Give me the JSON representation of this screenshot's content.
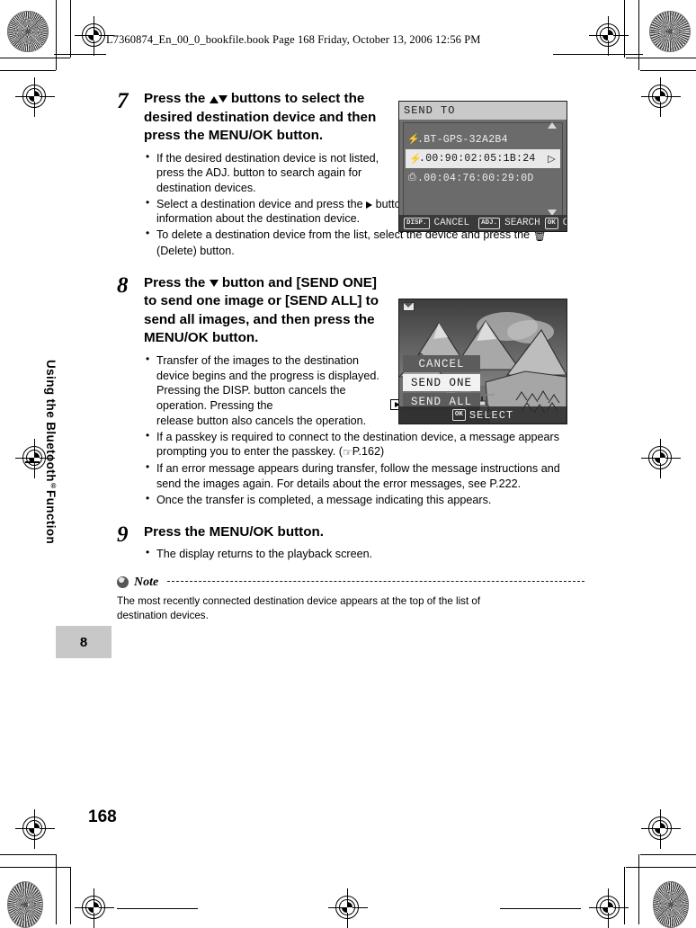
{
  "header": {
    "text": "L7360874_En_00_0_bookfile.book  Page 168  Friday, October 13, 2006  12:56 PM"
  },
  "sidebar": {
    "chapter_title": "Using the Bluetooth",
    "chapter_title_sup": "®",
    "chapter_title_tail": " Function",
    "chapter_number": "8"
  },
  "page": {
    "number": "168"
  },
  "steps": [
    {
      "number": "7",
      "title": "Press the ▲▼ buttons to select the desired destination device and then press the MENU/OK button.",
      "title_pre": "Press the ",
      "title_mid": " buttons to select the desired destination device and then press the MENU/OK button.",
      "bullets": [
        "If the desired destination device is not listed, press the ADJ. button to search again for destination devices.",
        "Select a destination device and press the ▶ button to display information about the destination device.",
        "To delete a destination device from the list, select the device and press the Ὕ1 (Delete) button."
      ],
      "bullet2_a": "Select a destination device and press the ",
      "bullet2_b": " button to display information about the destination device.",
      "bullet3_a": "To delete a destination device from the list, select the device and press the ",
      "bullet3_b": " (Delete) button."
    },
    {
      "number": "8",
      "title_a": "Press the ",
      "title_b": " button and [SEND ONE] to send one image or [SEND ALL] to send all images, and then press the MENU/OK button.",
      "bullet1_a": "Transfer of the images to the destination device begins and the progress is displayed. Pressing the DISP. button cancels the operation. Pressing the ",
      "bullet1_b": " (Playback) button or shutter release button also cancels the operation.",
      "bullet2_a": "If a passkey is required to connect to the destination device, a message appears prompting you to enter the passkey. (",
      "bullet2_b": "P.162)",
      "bullet3": "If an error message appears during transfer, follow the message instructions and send the images again. For details about the error messages, see P.222.",
      "bullet4": "Once the transfer is completed, a message indicating this appears."
    },
    {
      "number": "9",
      "title": "Press the MENU/OK button.",
      "bullets": [
        "The display returns to the playback screen."
      ]
    }
  ],
  "note": {
    "label": "Note",
    "text": "The most recently connected destination device appears at the top of the list of destination devices."
  },
  "lcd_send_to": {
    "title": "SEND TO",
    "rows": [
      {
        "icon": "bluetooth-icon",
        "glyph": "⚡",
        "label": ".BT-GPS-32A2B4",
        "selected": false
      },
      {
        "icon": "bluetooth-icon",
        "glyph": "⚡",
        "label": ".00:90:02:05:1B:24",
        "selected": true
      },
      {
        "icon": "printer-icon",
        "glyph": "⎙",
        "label": ".00:04:76:00:29:0D",
        "selected": false
      }
    ],
    "row_arrow": "▷",
    "footer": {
      "disp_key": "DISP.",
      "disp_label": "CANCEL",
      "adj_key": "ADJ.",
      "adj_label": "SEARCH",
      "ok_key": "OK",
      "ok_label": "OK"
    }
  },
  "lcd_send_menu": {
    "items": [
      {
        "label": "CANCEL",
        "selected": false
      },
      {
        "label": "SEND ONE",
        "selected": true
      },
      {
        "label": "SEND ALL",
        "selected": false
      }
    ],
    "footer": {
      "ok_key": "OK",
      "ok_label": "SELECT"
    }
  },
  "colors": {
    "chapter_tab_bg": "#c8c8c8",
    "lcd_bg": "#6e6e6e",
    "lcd_title_bg": "#c9c9c9",
    "lcd_selected_bg": "#e9e9e9",
    "lcd_footer_bg": "#3a3a3a"
  }
}
